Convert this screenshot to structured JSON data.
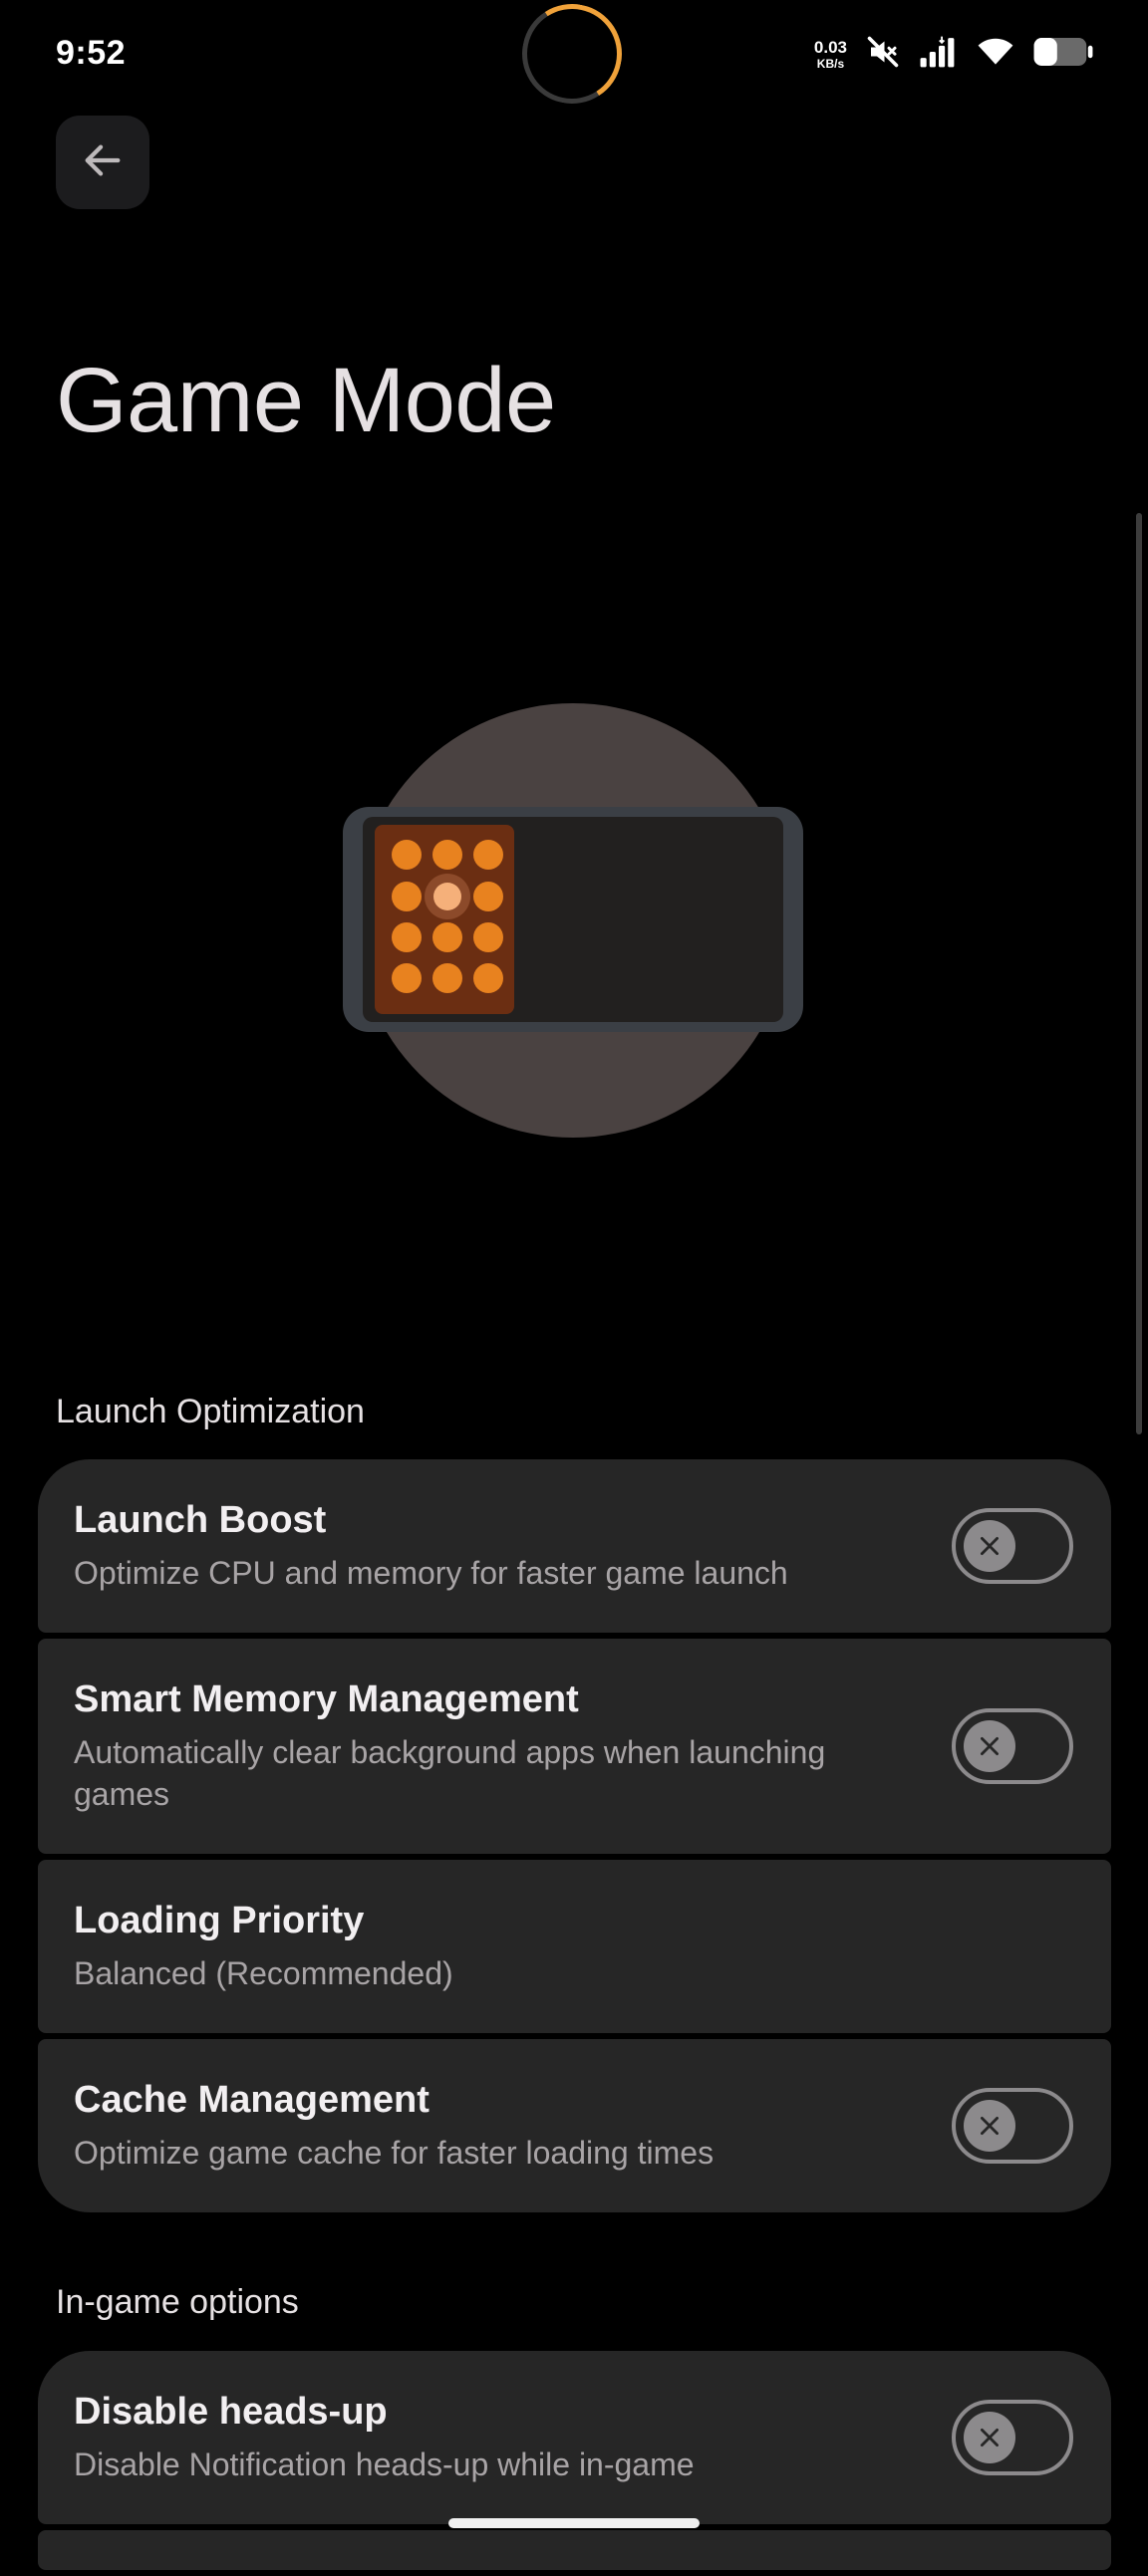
{
  "status_bar": {
    "time": "9:52",
    "net_speed_value": "0.03",
    "net_speed_unit": "KB/s",
    "icons": [
      "mute-icon",
      "signal-icon",
      "wifi-icon",
      "battery-icon"
    ]
  },
  "header": {
    "back_icon": "arrow-left-icon",
    "title": "Game Mode"
  },
  "colors": {
    "background": "#000000",
    "card": "#262626",
    "accent": "#e8821f",
    "toggle_off": "#8c8a8c"
  },
  "launch_section": {
    "header": "Launch Optimization",
    "items": [
      {
        "title": "Launch Boost",
        "subtitle": "Optimize CPU and memory for faster game launch",
        "toggle": "off"
      },
      {
        "title": "Smart Memory Management",
        "subtitle": "Automatically clear background apps when launching games",
        "toggle": "off"
      },
      {
        "title": "Loading Priority",
        "subtitle": "Balanced (Recommended)"
      },
      {
        "title": "Cache Management",
        "subtitle": "Optimize game cache for faster loading times",
        "toggle": "off"
      }
    ]
  },
  "ingame_section": {
    "header": "In-game options",
    "items": [
      {
        "title": "Disable heads-up",
        "subtitle": "Disable Notification heads-up while in-game",
        "toggle": "off"
      }
    ]
  }
}
